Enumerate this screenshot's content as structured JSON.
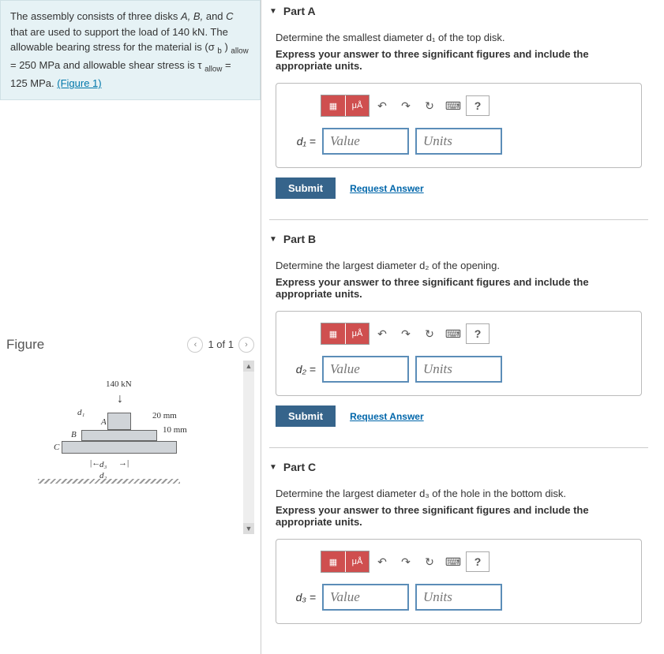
{
  "problem": {
    "text_before": "The assembly consists of three disks ",
    "disks": "A, B,",
    "text_and": " and ",
    "disk_c": "C",
    "text_mid": " that are used to support the load of 140 kN. The allowable bearing stress for the material is (σ",
    "sub_b": "b",
    "text_allow1": ")",
    "sub_allow1": "allow",
    "eq1": " = 250 MPa and allowable shear stress is τ",
    "sub_allow2": "allow",
    "eq2": " = 125 MPa. ",
    "figure_link": "(Figure 1)"
  },
  "figure": {
    "title": "Figure",
    "nav_text": "1 of 1",
    "load_label": "140 kN",
    "dim_20": "20 mm",
    "dim_10": "10 mm",
    "d1": "d₁",
    "d2": "d₂",
    "d3": "d₃",
    "A": "A",
    "B": "B",
    "C": "C"
  },
  "toolbar": {
    "tmpl": "▦",
    "mu": "μÅ",
    "undo": "↶",
    "redo": "↷",
    "reset": "↻",
    "keyboard": "⌨",
    "help": "?"
  },
  "parts": {
    "a": {
      "title": "Part A",
      "question": "Determine the smallest diameter d₁ of the top disk.",
      "instruction": "Express your answer to three significant figures and include the appropriate units.",
      "var": "d₁ =",
      "value_ph": "Value",
      "units_ph": "Units",
      "submit": "Submit",
      "request": "Request Answer"
    },
    "b": {
      "title": "Part B",
      "question": "Determine the largest diameter d₂ of the opening.",
      "instruction": "Express your answer to three significant figures and include the appropriate units.",
      "var": "d₂ =",
      "value_ph": "Value",
      "units_ph": "Units",
      "submit": "Submit",
      "request": "Request Answer"
    },
    "c": {
      "title": "Part C",
      "question": "Determine the largest diameter d₃ of the hole in the bottom disk.",
      "instruction": "Express your answer to three significant figures and include the appropriate units.",
      "var": "d₃ =",
      "value_ph": "Value",
      "units_ph": "Units"
    }
  }
}
